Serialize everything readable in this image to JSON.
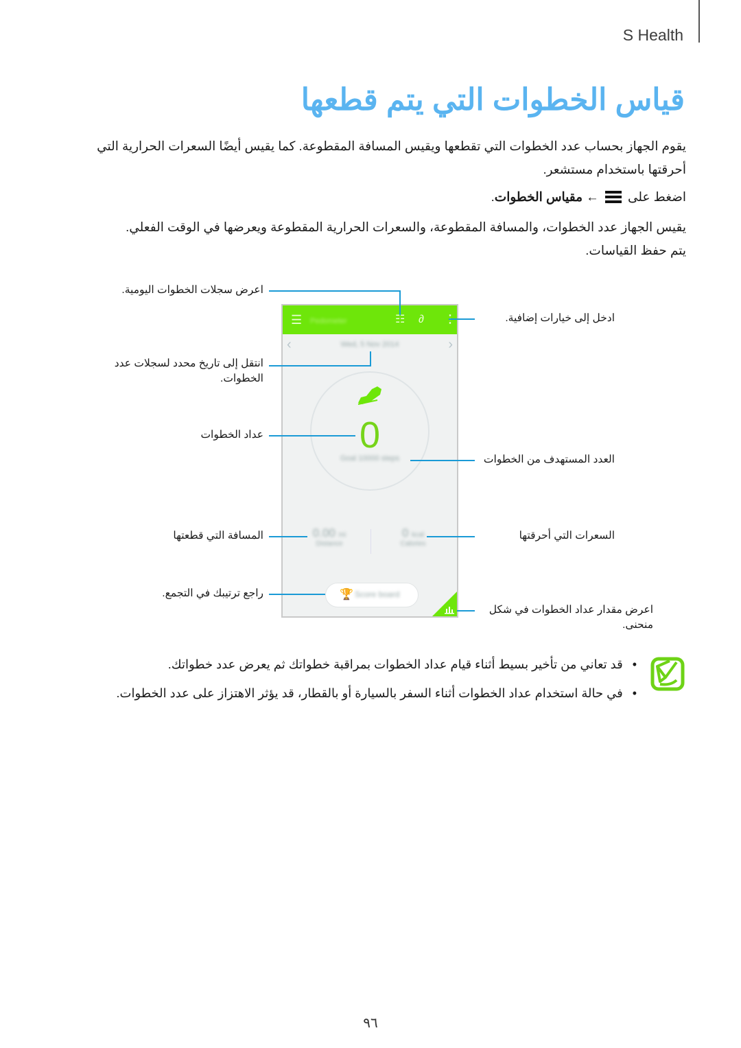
{
  "header": {
    "section_label": "S Health"
  },
  "title": "قياس الخطوات التي يتم قطعها",
  "intro": {
    "paragraph": "يقوم الجهاز بحساب عدد الخطوات التي تقطعها ويقيس المسافة المقطوعة. كما يقيس أيضًا السعرات الحرارية التي أحرقتها باستخدام مستشعر.",
    "instruction_prefix": "اضغط على",
    "instruction_arrow": "←",
    "instruction_target": "مقياس الخطوات",
    "instruction_suffix": ".",
    "measure_paragraph": "يقيس الجهاز عدد الخطوات، والمسافة المقطوعة، والسعرات الحرارية المقطوعة ويعرضها في الوقت الفعلي.",
    "saved_paragraph": "يتم حفظ القياسات."
  },
  "phone": {
    "app_title": "Pedometer",
    "date": "Wed, 5 Nov 2014",
    "steps_value": "0",
    "goal_text": "Goal 10000 steps",
    "distance_value": "0.00",
    "distance_unit": "mi",
    "distance_label": "Distance",
    "calories_value": "0",
    "calories_unit": "kcal",
    "calories_label": "Calories",
    "score_board_label": "Score board",
    "icons": [
      "menu-icon",
      "list-icon",
      "link-icon",
      "more-options-icon",
      "chevron-left-icon",
      "chevron-right-icon",
      "shoe-icon",
      "trophy-icon",
      "bar-chart-icon"
    ]
  },
  "callouts": {
    "daily_records": "اعرض سجلات الخطوات اليومية.",
    "more_options": "ادخل إلى خيارات إضافية.",
    "go_to_date": "انتقل إلى تاريخ محدد لسجلات عدد الخطوات.",
    "step_counter": "عداد الخطوات",
    "target_steps": "العدد المستهدف من الخطوات",
    "distance": "المسافة التي قطعتها",
    "calories": "السعرات التي أحرقتها",
    "ranking": "راجع ترتيبك في التجمع.",
    "graph": "اعرض مقدار عداد الخطوات في شكل منحنى."
  },
  "notes": [
    "قد تعاني من تأخير بسيط أثناء قيام عداد الخطوات بمراقبة خطواتك ثم يعرض عدد خطواتك.",
    "في حالة استخدام عداد الخطوات أثناء السفر بالسيارة أو بالقطار، قد يؤثر الاهتزاز على عدد الخطوات."
  ],
  "page_number": "٩٦",
  "colors": {
    "title": "#5ab4f0",
    "app_green": "#6ee60a",
    "callout_line": "#1a9ad6",
    "note_icon": "#6ed316"
  }
}
